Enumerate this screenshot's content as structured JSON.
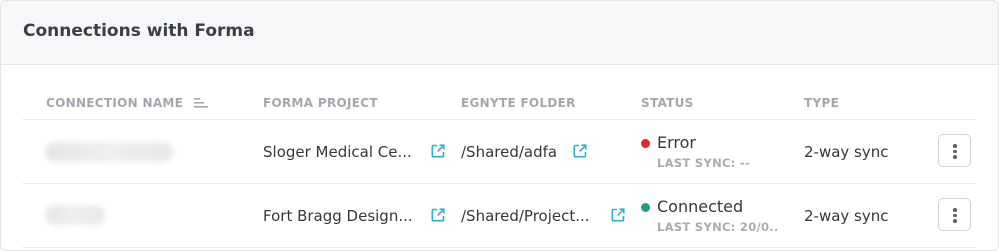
{
  "header": {
    "title": "Connections with Forma"
  },
  "table": {
    "columns": {
      "connection_name": "CONNECTION NAME",
      "forma_project": "FORMA PROJECT",
      "egnyte_folder": "EGNYTE FOLDER",
      "status": "STATUS",
      "type": "TYPE"
    },
    "rows": [
      {
        "forma_project": "Sloger Medical Ce...",
        "egnyte_folder": "/Shared/adfa",
        "status": "Error",
        "last_sync": "LAST SYNC: --",
        "type": "2-way sync",
        "status_color": "#e5252d"
      },
      {
        "forma_project": "Fort Bragg Design...",
        "egnyte_folder": "/Shared/Project...",
        "status": "Connected",
        "last_sync": "LAST SYNC: 20/0..",
        "type": "2-way sync",
        "status_color": "#1e9e82"
      }
    ]
  },
  "icons": {
    "sort": "sort-lines-icon",
    "external_link": "external-link-icon",
    "menu": "vertical-ellipsis-icon"
  },
  "colors": {
    "link_icon": "#2ab3c6",
    "error": "#e5252d",
    "connected": "#1e9e82"
  }
}
